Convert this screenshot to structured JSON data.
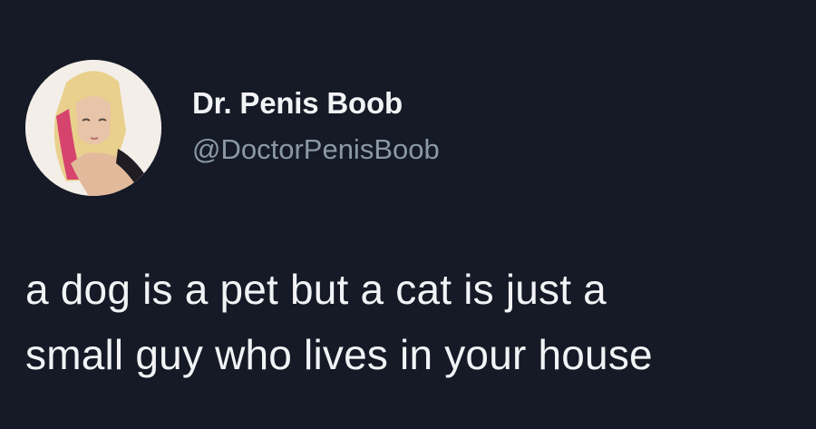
{
  "tweet": {
    "author": {
      "display_name": "Dr. Penis Boob",
      "handle": "@DoctorPenisBoob",
      "avatar_icon": "profile-photo-avatar"
    },
    "text_lines": [
      "a dog is a pet but a cat is just a",
      "small guy who lives in your house"
    ]
  },
  "colors": {
    "background": "#151a26",
    "primary_text": "#f1f3f5",
    "secondary_text": "#8b98a5"
  }
}
